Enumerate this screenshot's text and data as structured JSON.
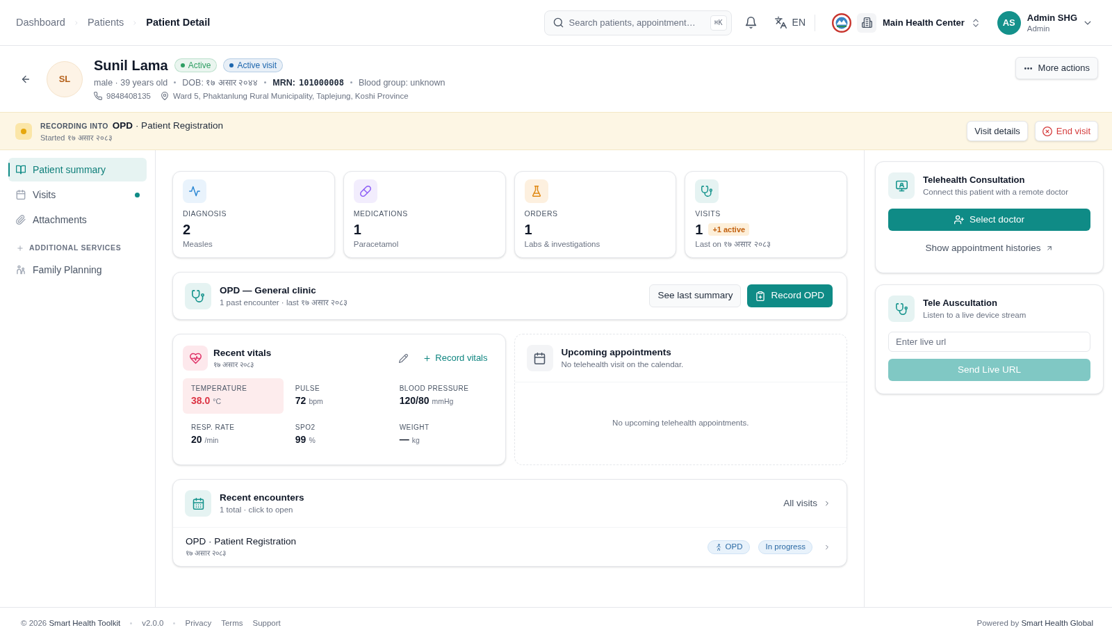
{
  "breadcrumbs": [
    {
      "label": "Dashboard",
      "current": false
    },
    {
      "label": "Patients",
      "current": false
    },
    {
      "label": "Patient Detail",
      "current": true
    }
  ],
  "search": {
    "placeholder": "Search patients, appointment…",
    "shortcut": "⌘K"
  },
  "language": "EN",
  "facility": "Main Health Center",
  "user": {
    "initials": "AS",
    "name": "Admin SHG",
    "role": "Admin"
  },
  "patient": {
    "initials": "SL",
    "name": "Sunil Lama",
    "badges": [
      {
        "label": "Active",
        "color": "#2f9e63"
      },
      {
        "label": "Active visit",
        "color": "#1d66ad"
      }
    ],
    "summary": "male · 39 years old",
    "dob": "DOB: १७ असार २०४४",
    "mrn": {
      "label": "MRN:",
      "value": "101000008"
    },
    "blood_group": "Blood group: unknown",
    "phone": "9848408135",
    "address": "Ward 5, Phaktanlung Rural Municipality, Taplejung, Koshi Province"
  },
  "more_actions": "More actions",
  "recording": {
    "label": "RECORDING INTO",
    "title": "**OPD** · Patient Registration",
    "started": "Started १७ असार २०८३",
    "visit_details": "Visit details",
    "end_visit": "End visit"
  },
  "sidebar": {
    "items": [
      {
        "label": "Patient summary",
        "selected": true,
        "indicator": false
      },
      {
        "label": "Visits",
        "selected": false,
        "indicator": true
      },
      {
        "label": "Attachments",
        "selected": false,
        "indicator": false
      }
    ],
    "section": {
      "label": "ADDITIONAL SERVICES",
      "items": [
        {
          "label": "Family Planning",
          "selected": false
        }
      ]
    }
  },
  "stats": [
    {
      "label": "DIAGNOSIS",
      "count": "2",
      "detail": "Measles"
    },
    {
      "label": "MEDICATIONS",
      "count": "1",
      "detail": "Paracetamol"
    },
    {
      "label": "ORDERS",
      "count": "1",
      "detail": "Labs & investigations"
    },
    {
      "label": "VISITS",
      "count": "1",
      "badge": "+1 active",
      "detail": "Last on १७ असार २०८३"
    }
  ],
  "service_card": {
    "title": "OPD — General clinic",
    "subtitle": "1 past encounter · last १७ असार २०८३",
    "secondary_action": "See last summary",
    "primary_action": "Record OPD"
  },
  "vitals": {
    "title": "Recent vitals",
    "date": "१७ असार २०८३",
    "action": "Record vitals",
    "readings": [
      {
        "label": "TEMPERATURE",
        "value": "38.0",
        "unit": "°C",
        "abnormal": true
      },
      {
        "label": "PULSE",
        "value": "72",
        "unit": "bpm",
        "abnormal": false
      },
      {
        "label": "BLOOD PRESSURE",
        "value": "120/80",
        "unit": "mmHg",
        "abnormal": false
      },
      {
        "label": "RESP. RATE",
        "value": "20",
        "unit": "/min",
        "abnormal": false
      },
      {
        "label": "SPO2",
        "value": "99",
        "unit": "%",
        "abnormal": false
      },
      {
        "label": "WEIGHT",
        "value": "—",
        "unit": "kg",
        "abnormal": false
      }
    ]
  },
  "appointments": {
    "title": "Upcoming appointments",
    "subtitle": "No telehealth visit on the calendar.",
    "empty": "No upcoming telehealth appointments."
  },
  "encounters": {
    "title": "Recent encounters",
    "subtitle": "1 total · click to open",
    "link": "All visits",
    "rows": [
      {
        "title": "OPD · Patient Registration",
        "date": "१७ असार २०८३",
        "tags": [
          {
            "kind": "service",
            "label": "OPD"
          },
          {
            "kind": "status",
            "label": "In progress"
          }
        ]
      }
    ]
  },
  "telehealth": {
    "title": "Telehealth Consultation",
    "subtitle": "Connect this patient with a remote doctor",
    "action": "Select doctor",
    "link": "Show appointment histories"
  },
  "auscultation": {
    "title": "Tele Auscultation",
    "subtitle": "Listen to a live device stream",
    "placeholder": "Enter live url",
    "action": "Send Live URL",
    "disabled": true
  },
  "footer": {
    "copyright": "© 2026 **Smart Health Toolkit**",
    "version": "v2.0.0",
    "links": [
      "Privacy",
      "Terms",
      "Support"
    ],
    "powered_by": "Powered by **Smart Health Global**"
  }
}
